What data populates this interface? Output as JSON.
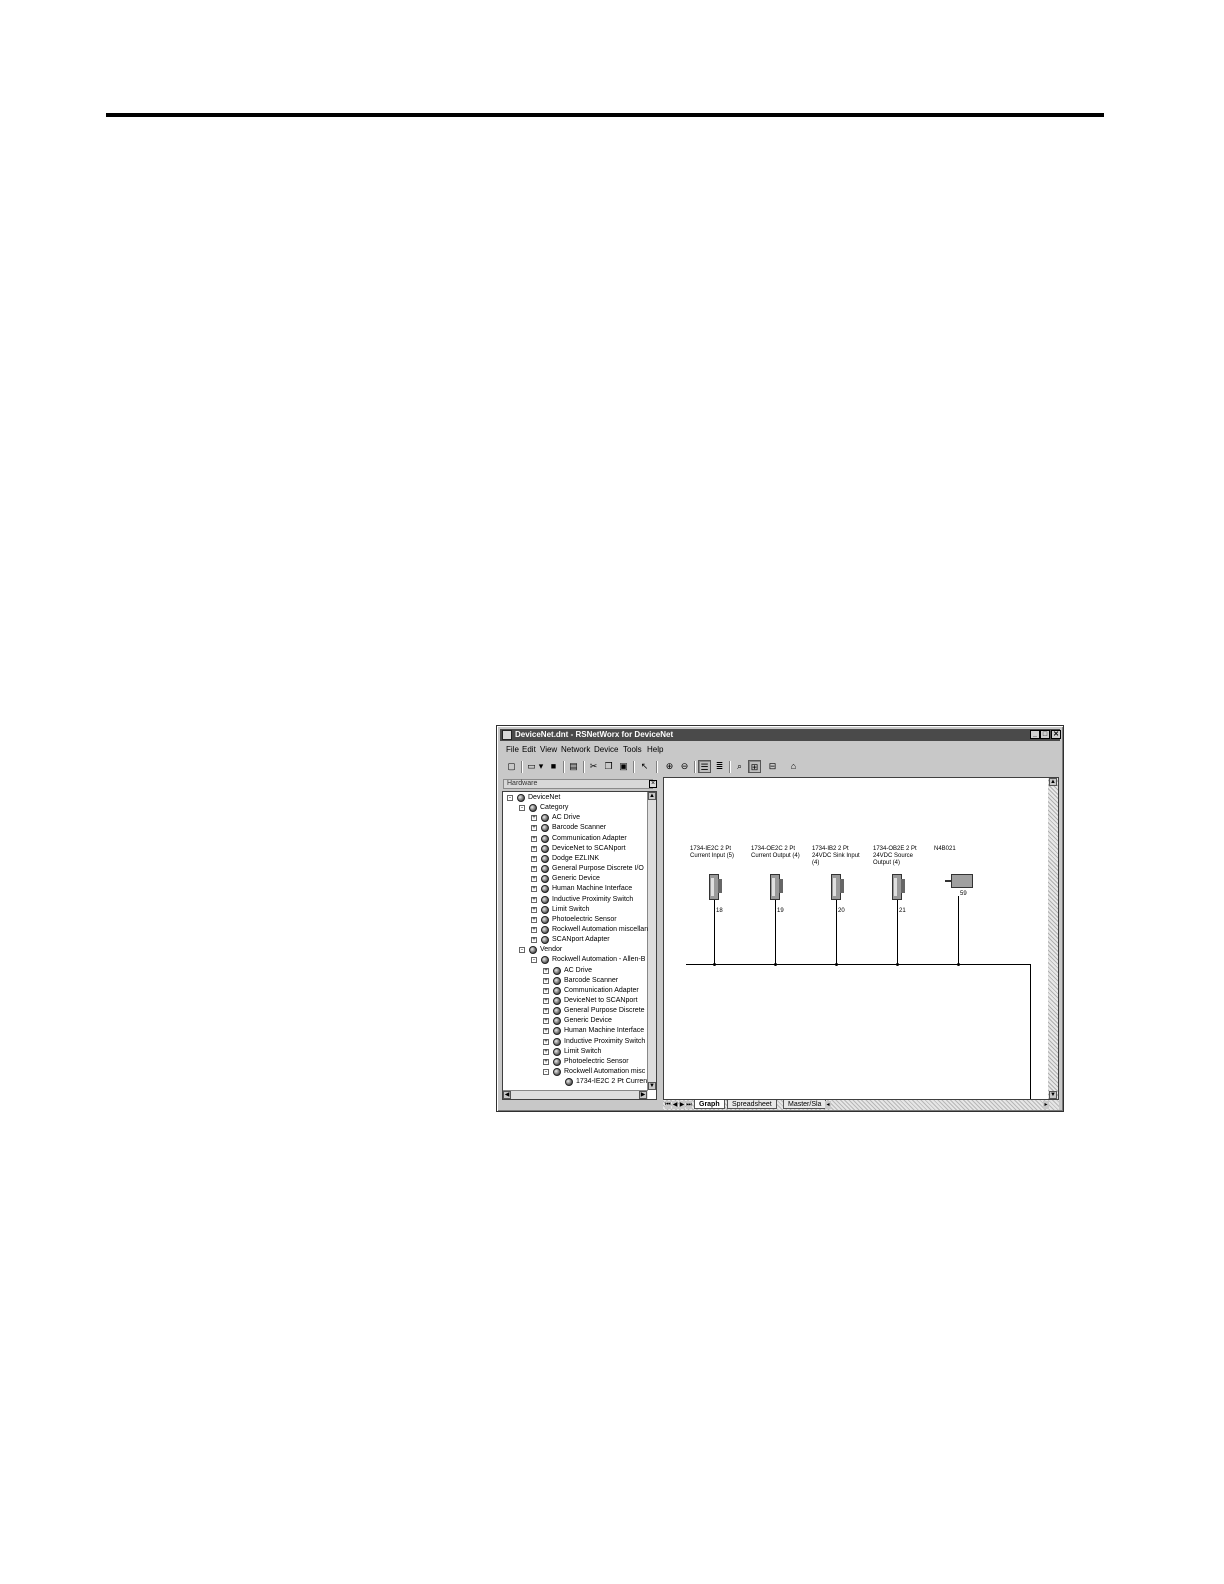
{
  "window": {
    "title": "DeviceNet.dnt - RSNetWorx for DeviceNet",
    "controls": {
      "minimize": "_",
      "maximize": "□",
      "close": "✕"
    }
  },
  "menu": [
    "File",
    "Edit",
    "View",
    "Network",
    "Device",
    "Tools",
    "Help"
  ],
  "hardware_panel": {
    "label": "Hardware"
  },
  "tree": [
    {
      "text": "DeviceNet",
      "level": 0,
      "expander": "-"
    },
    {
      "text": "Category",
      "level": 1,
      "expander": "-"
    },
    {
      "text": "AC Drive",
      "level": 2,
      "expander": "+"
    },
    {
      "text": "Barcode Scanner",
      "level": 2,
      "expander": "+"
    },
    {
      "text": "Communication Adapter",
      "level": 2,
      "expander": "+"
    },
    {
      "text": "DeviceNet to SCANport",
      "level": 2,
      "expander": "+"
    },
    {
      "text": "Dodge EZLINK",
      "level": 2,
      "expander": "+"
    },
    {
      "text": "General Purpose Discrete I/O",
      "level": 2,
      "expander": "+"
    },
    {
      "text": "Generic Device",
      "level": 2,
      "expander": "+"
    },
    {
      "text": "Human Machine Interface",
      "level": 2,
      "expander": "+"
    },
    {
      "text": "Inductive Proximity Switch",
      "level": 2,
      "expander": "+"
    },
    {
      "text": "Limit Switch",
      "level": 2,
      "expander": "+"
    },
    {
      "text": "Photoelectric Sensor",
      "level": 2,
      "expander": "+"
    },
    {
      "text": "Rockwell Automation miscellan",
      "level": 2,
      "expander": "+"
    },
    {
      "text": "SCANport Adapter",
      "level": 2,
      "expander": "+"
    },
    {
      "text": "Vendor",
      "level": 1,
      "expander": "-"
    },
    {
      "text": "Rockwell Automation - Allen-B",
      "level": 2,
      "expander": "-"
    },
    {
      "text": "AC Drive",
      "level": 3,
      "expander": "+"
    },
    {
      "text": "Barcode Scanner",
      "level": 3,
      "expander": "+"
    },
    {
      "text": "Communication Adapter",
      "level": 3,
      "expander": "+"
    },
    {
      "text": "DeviceNet to SCANport",
      "level": 3,
      "expander": "+"
    },
    {
      "text": "General Purpose Discrete",
      "level": 3,
      "expander": "+"
    },
    {
      "text": "Generic Device",
      "level": 3,
      "expander": "+"
    },
    {
      "text": "Human Machine Interface",
      "level": 3,
      "expander": "+"
    },
    {
      "text": "Inductive Proximity Switch",
      "level": 3,
      "expander": "+"
    },
    {
      "text": "Limit Switch",
      "level": 3,
      "expander": "+"
    },
    {
      "text": "Photoelectric Sensor",
      "level": 3,
      "expander": "+"
    },
    {
      "text": "Rockwell Automation misc",
      "level": 3,
      "expander": "-"
    },
    {
      "text": "1734-IE2C 2 Pt Curren",
      "level": 4,
      "expander": ""
    }
  ],
  "devices": [
    {
      "label": "1734-IE2C 2 Pt\nCurrent Input (5)",
      "node": "18",
      "kind": "module"
    },
    {
      "label": "1734-OE2C 2 Pt\nCurrent Output (4)",
      "node": "19",
      "kind": "module"
    },
    {
      "label": "1734-IB2 2 Pt\n24VDC Sink Input\n(4)",
      "node": "20",
      "kind": "module"
    },
    {
      "label": "1734-OB2E 2 Pt\n24VDC Source\nOutput (4)",
      "node": "21",
      "kind": "module"
    },
    {
      "label": "N4B021",
      "node": "59",
      "kind": "motor"
    }
  ],
  "tabs": [
    {
      "label": "Graph",
      "active": true
    },
    {
      "label": "Spreadsheet",
      "active": false
    },
    {
      "label": "Master/Sla",
      "active": false
    }
  ]
}
